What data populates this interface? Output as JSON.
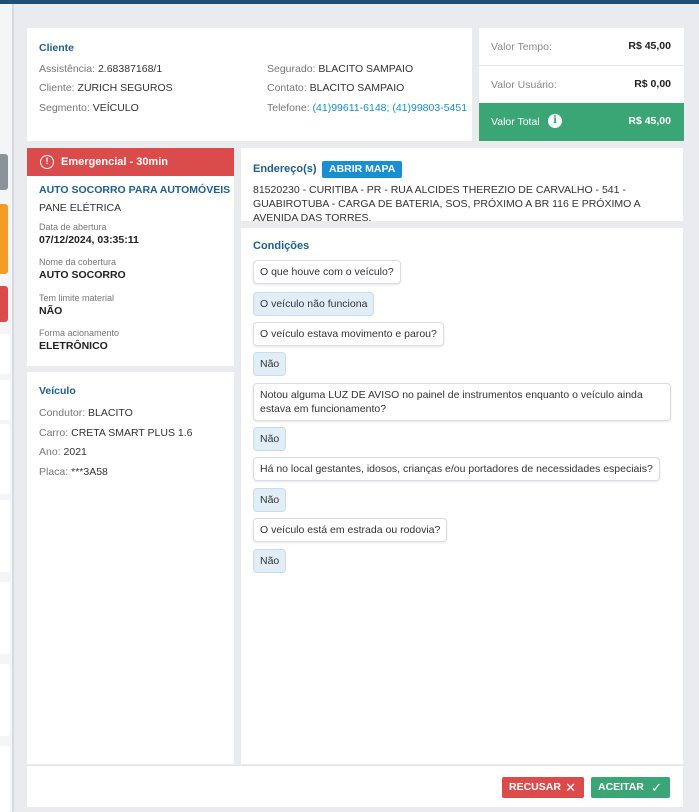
{
  "cliente": {
    "title": "Cliente",
    "assistencia_label": "Assistência:",
    "assistencia_value": "2.68387168/1",
    "cliente_label": "Cliente:",
    "cliente_value": "ZURICH SEGUROS",
    "segmento_label": "Segmento:",
    "segmento_value": "VEÍCULO",
    "segurado_label": "Segurado:",
    "segurado_value": "BLACITO SAMPAIO",
    "contato_label": "Contato:",
    "contato_value": "BLACITO SAMPAIO",
    "telefone_label": "Telefone:",
    "telefone_value": "(41)99611-6148; (41)99803-5451"
  },
  "valores": {
    "tempo_label": "Valor Tempo:",
    "tempo_value": "R$ 45,00",
    "usuario_label": "Valor Usuário:",
    "usuario_value": "R$ 0,00",
    "total_label": "Valor Total",
    "total_value": "R$ 45,00",
    "total_color": "#3aa575"
  },
  "emergencial": {
    "header": "Emergencial - 30min",
    "header_color": "#dc4b4b",
    "service": "AUTO SOCORRO PARA AUTOMÓVEIS",
    "problem": "PANE ELÉTRICA",
    "abertura_label": "Data de abertura",
    "abertura_value": "07/12/2024, 03:35:11",
    "cobertura_label": "Nome da cobertura",
    "cobertura_value": "AUTO SOCORRO",
    "limite_label": "Tem limite material",
    "limite_value": "NÃO",
    "acionamento_label": "Forma acionamento",
    "acionamento_value": "ELETRÔNICO"
  },
  "veiculo": {
    "title": "Veículo",
    "condutor_label": "Condutor:",
    "condutor_value": "BLACITO",
    "carro_label": "Carro:",
    "carro_value": "CRETA SMART PLUS 1.6",
    "ano_label": "Ano:",
    "ano_value": "2021",
    "placa_label": "Placa:",
    "placa_value": "***3A58"
  },
  "endereco": {
    "title": "Endereço(s)",
    "map_button": "ABRIR MAPA",
    "address": "81520230 - CURITIBA - PR - RUA ALCIDES THEREZIO DE CARVALHO - 541 - GUABIROTUBA - CARGA DE BATERIA, SOS, PRÓXIMO A BR 116 E PRÓXIMO A AVENIDA DAS TORRES."
  },
  "condicoes": {
    "title": "Condições",
    "items": [
      {
        "question": "O que houve com o veículo?",
        "answer": "O veículo não funciona"
      },
      {
        "question": "O veículo estava movimento e parou?",
        "answer": "Não"
      },
      {
        "question": "Notou alguma LUZ DE AVISO no painel de instrumentos enquanto o veículo ainda estava em funcionamento?",
        "answer": "Não"
      },
      {
        "question": "Há no local gestantes, idosos, crianças e/ou portadores de necessidades especiais?",
        "answer": "Não"
      },
      {
        "question": "O veículo está em estrada ou rodovia?",
        "answer": "Não"
      }
    ]
  },
  "footer": {
    "recusar": "RECUSAR",
    "aceitar": "ACEITAR"
  }
}
